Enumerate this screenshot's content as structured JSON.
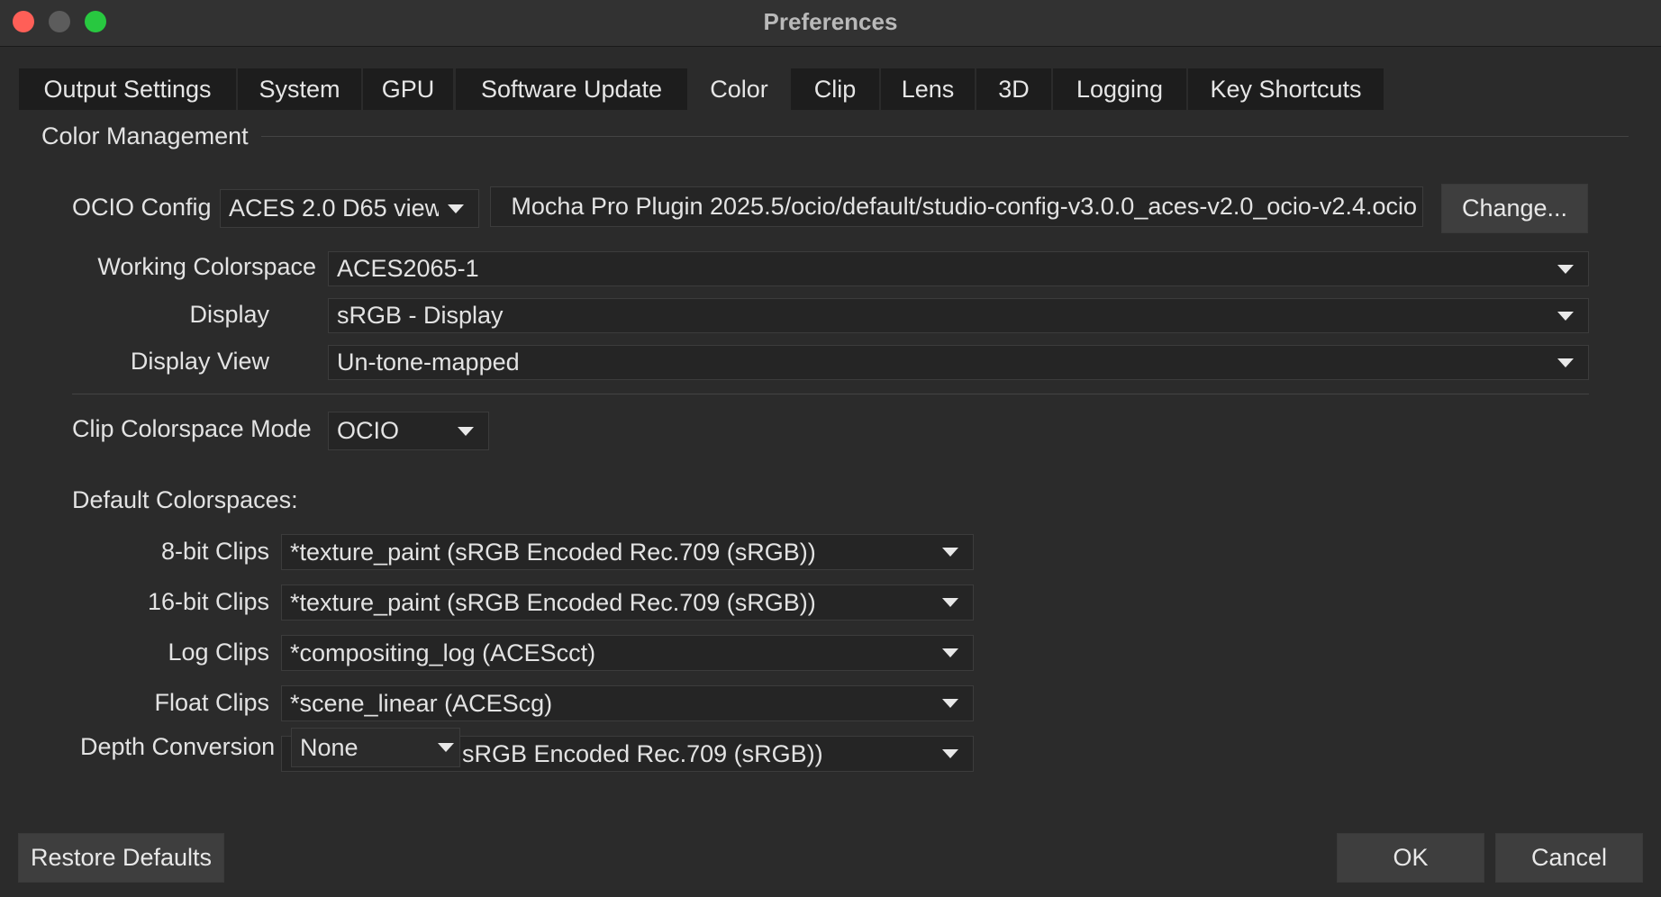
{
  "window": {
    "title": "Preferences"
  },
  "tabs": [
    {
      "label": "Output Settings",
      "active": false
    },
    {
      "label": "System",
      "active": false
    },
    {
      "label": "GPU",
      "active": false
    },
    {
      "label": "Software Update",
      "active": false
    },
    {
      "label": "Color",
      "active": true
    },
    {
      "label": "Clip",
      "active": false
    },
    {
      "label": "Lens",
      "active": false
    },
    {
      "label": "3D",
      "active": false
    },
    {
      "label": "Logging",
      "active": false
    },
    {
      "label": "Key Shortcuts",
      "active": false
    }
  ],
  "color_management": {
    "title": "Color Management",
    "ocio_config": {
      "label": "OCIO Config",
      "preset": "ACES 2.0 D65 view",
      "path": "Mocha Pro Plugin 2025.5/ocio/default/studio-config-v3.0.0_aces-v2.0_ocio-v2.4.ocio",
      "change_label": "Change..."
    },
    "working_colorspace": {
      "label": "Working Colorspace",
      "value": "ACES2065-1"
    },
    "display": {
      "label": "Display",
      "value": "sRGB - Display"
    },
    "display_view": {
      "label": "Display View",
      "value": "Un-tone-mapped"
    },
    "clip_colorspace_mode": {
      "label": "Clip Colorspace Mode",
      "value": "OCIO"
    },
    "default_colorspaces": {
      "title": "Default Colorspaces:",
      "bit8": {
        "label": "8-bit Clips",
        "value": "*texture_paint (sRGB Encoded Rec.709 (sRGB))"
      },
      "bit16": {
        "label": "16-bit Clips",
        "value": "*texture_paint (sRGB Encoded Rec.709 (sRGB))"
      },
      "log": {
        "label": "Log Clips",
        "value": "*compositing_log (ACEScct)"
      },
      "float": {
        "label": "Float Clips",
        "value": "*scene_linear (ACEScg)"
      },
      "depth_conversion": {
        "label": "Depth Conversion",
        "value": "None"
      },
      "hidden_row_value": "sRGB Encoded Rec.709 (sRGB))"
    }
  },
  "footer": {
    "restore_label": "Restore Defaults",
    "ok_label": "OK",
    "cancel_label": "Cancel"
  },
  "colors": {
    "background": "#2b2b2b",
    "tab_inactive": "#1d1d1d",
    "field": "#252525",
    "button": "#3e3e3e",
    "close": "#ff5f57",
    "minimize": "#5c5c5c",
    "maximize": "#28c840"
  }
}
